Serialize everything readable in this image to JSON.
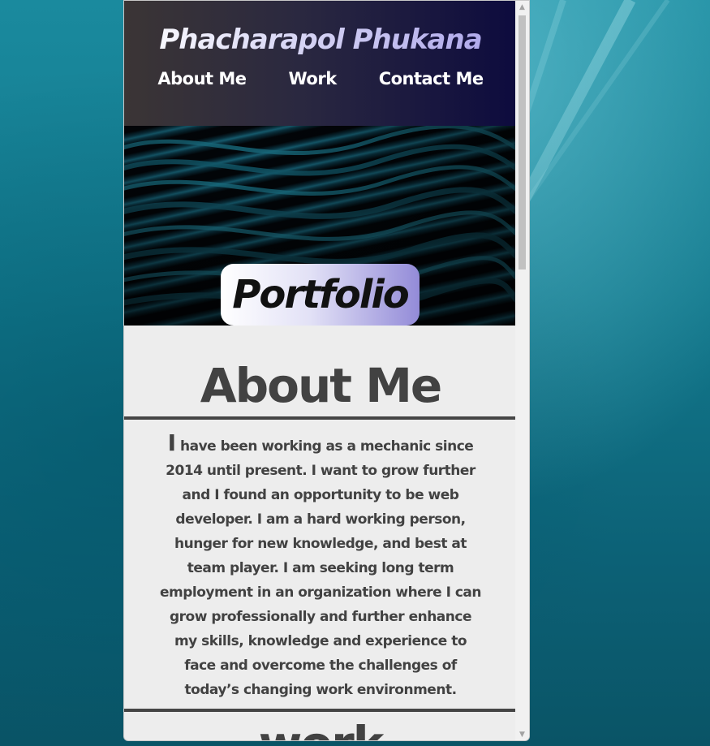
{
  "site": {
    "title": "Phacharapol Phukana"
  },
  "nav": {
    "items": [
      "About Me",
      "Work",
      "Contact Me"
    ]
  },
  "hero": {
    "badge": "Portfolio"
  },
  "about": {
    "title": "About Me",
    "dropcap": "I",
    "text": " have been working as a mechanic since 2014 until present. I want to grow further and I found an opportunity to be web developer. I am a hard working person, hunger for new knowledge, and best at team player. I am seeking long term employment in an organization where I can grow professionally and further enhance my skills, knowledge and experience to face and overcome the challenges of today’s changing work environment."
  },
  "work": {
    "title": "work"
  },
  "scrollbar": {
    "up_icon": "▲",
    "down_icon": "▼"
  },
  "colors": {
    "header_start": "#3b3535",
    "header_end": "#0d0b3e",
    "text": "#424242",
    "page_bg": "#ededed"
  }
}
